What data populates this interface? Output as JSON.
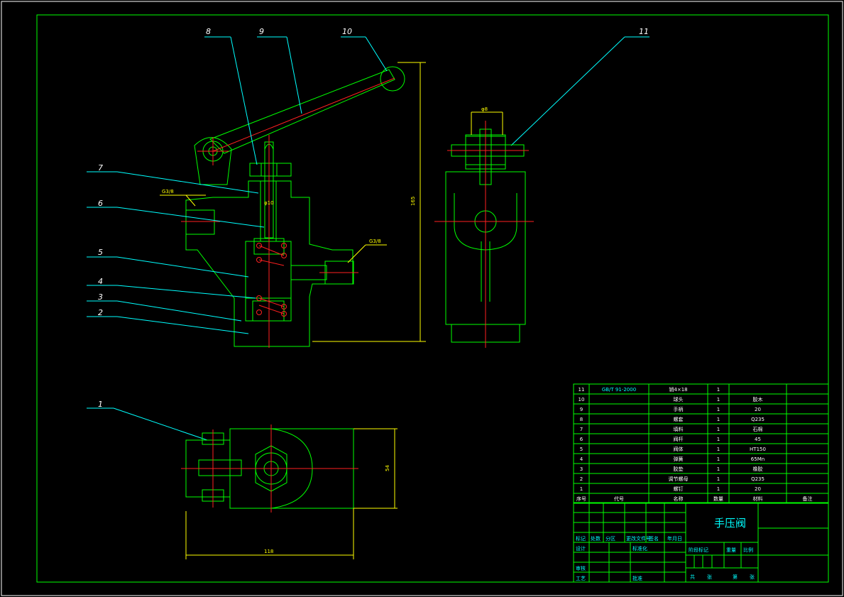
{
  "balloons": [
    "1",
    "2",
    "3",
    "4",
    "5",
    "6",
    "7",
    "8",
    "9",
    "10",
    "11"
  ],
  "dims": {
    "thread_left": "G3/8",
    "thread_right": "G3/8",
    "height": "165",
    "width": "118",
    "depth": "54",
    "bore": "φ10",
    "side_top": "φ8"
  },
  "bom": {
    "header": [
      "序号",
      "代号",
      "名称",
      "数量",
      "材料",
      "备注"
    ],
    "rows": [
      [
        "11",
        "GB/T 91-2000",
        "销4×18",
        "1",
        "",
        ""
      ],
      [
        "10",
        "",
        "球头",
        "1",
        "胶木",
        ""
      ],
      [
        "9",
        "",
        "手柄",
        "1",
        "20",
        ""
      ],
      [
        "8",
        "",
        "螺套",
        "1",
        "Q235",
        ""
      ],
      [
        "7",
        "",
        "填料",
        "1",
        "石棉",
        ""
      ],
      [
        "6",
        "",
        "阀杆",
        "1",
        "45",
        ""
      ],
      [
        "5",
        "",
        "阀体",
        "1",
        "HT150",
        ""
      ],
      [
        "4",
        "",
        "弹簧",
        "1",
        "65Mn",
        ""
      ],
      [
        "3",
        "",
        "胶垫",
        "1",
        "橡胶",
        ""
      ],
      [
        "2",
        "",
        "调节螺母",
        "1",
        "Q235",
        ""
      ],
      [
        "1",
        "",
        "螺钉",
        "1",
        "20",
        ""
      ]
    ]
  },
  "title_block": {
    "name": "手压阀",
    "rev_labels": [
      "标记",
      "处数",
      "分区",
      "更改文件号",
      "签名",
      "年月日"
    ],
    "design": "设计",
    "standard": "标准化",
    "review": "审核",
    "process": "工艺",
    "approve": "批准",
    "stage": "阶段标记",
    "weight": "重量",
    "scale": "比例",
    "sheets_total": "共",
    "sheets_unit": "张",
    "sheet_no": "第",
    "sheet_unit": "张"
  }
}
